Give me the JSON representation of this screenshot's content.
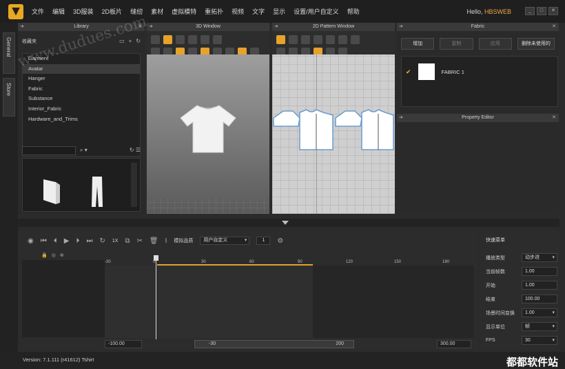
{
  "menubar": {
    "items": [
      "文件",
      "编辑",
      "3D服装",
      "2D板片",
      "缝纫",
      "素材",
      "虚拟模特",
      "重拓扑",
      "视频",
      "文字",
      "显示",
      "设置/用户自定义",
      "帮助"
    ],
    "hello": "Hello,",
    "user": "HBSWEB"
  },
  "sidetabs": [
    "General",
    "Store"
  ],
  "library": {
    "title": "Library",
    "favorites": "收藏夹",
    "items": [
      "Garment",
      "Avatar",
      "Hanger",
      "Fabric",
      "Substance",
      "Interior_Fabric",
      "Hardware_and_Trims"
    ],
    "selected_index": 1
  },
  "win3d": {
    "title": "3D Window"
  },
  "win2d": {
    "title": "2D Pattern Window"
  },
  "fabric": {
    "title": "Fabric",
    "buttons": [
      "增加",
      "复制",
      "应用",
      "删除未使用的"
    ],
    "items": [
      {
        "name": "FABRIC 1"
      }
    ]
  },
  "property_editor": {
    "title": "Property Editor"
  },
  "timeline": {
    "speed_label": "1X",
    "mode_label": "模拟品质",
    "mode_value": "用户自定义",
    "count": "1",
    "ticks": [
      "-30",
      "0",
      "30",
      "60",
      "90",
      "120",
      "150",
      "180"
    ],
    "start_field": "-100.00",
    "range_start": "-30",
    "range_end": "200",
    "end_field": "300.00"
  },
  "quick_menu": {
    "title": "快速菜单",
    "rows": [
      {
        "label": "播放类型",
        "value": "动步进",
        "dropdown": true
      },
      {
        "label": "当前帧数",
        "value": "1.00",
        "dropdown": false
      },
      {
        "label": "开始",
        "value": "1.00",
        "dropdown": false
      },
      {
        "label": "结束",
        "value": "100.00",
        "dropdown": false
      },
      {
        "label": "场景时间变换",
        "value": "1.00",
        "dropdown": true
      },
      {
        "label": "显示单位",
        "value": "帧",
        "dropdown": true
      },
      {
        "label": "FPS",
        "value": "30",
        "dropdown": true
      }
    ]
  },
  "status": {
    "version": "Version:   7.1.111 (r41612)    Tshirt"
  },
  "brand": "都都软件站",
  "watermark": "www.dudues.com"
}
